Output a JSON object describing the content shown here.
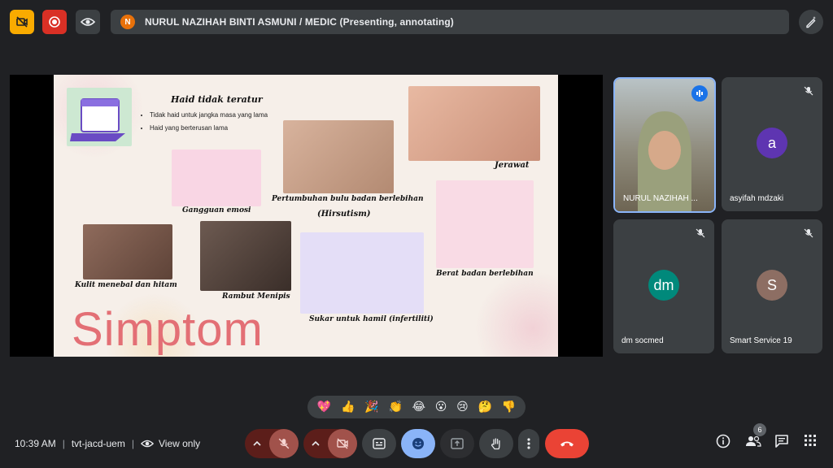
{
  "banner": {
    "presenter_initial": "N",
    "presenter_text": "NURUL NAZIHAH BINTI ASMUNI / MEDIC (Presenting, annotating)"
  },
  "slide": {
    "heading": "Haid tidak teratur",
    "bullets": [
      "Tidak haid untuk jangka masa yang lama",
      "Haid yang berterusan lama"
    ],
    "labels": {
      "gangguan": "Gangguan emosi",
      "pertumbuhan": "Pertumbuhan bulu badan berlebihan",
      "hirsutism": "(Hirsutism)",
      "jerawat": "Jerawat",
      "kulit": "Kulit menebal dan hitam",
      "rambut": "Rambut Menipis",
      "berat": "Berat badan berlebihan",
      "sukar": "Sukar untuk hamil (infertiliti)"
    },
    "title": "Simptom"
  },
  "participants": [
    {
      "name": "NURUL NAZIHAH ...",
      "type": "video"
    },
    {
      "name": "asyifah mdzaki",
      "initials": "a",
      "color": "#5e35b1"
    },
    {
      "name": "dm socmed",
      "initials": "dm",
      "color": "#00897b"
    },
    {
      "name": "Smart Service 19",
      "initials": "S",
      "color": "#8d6e63"
    }
  ],
  "reactions": [
    "💖",
    "👍",
    "🎉",
    "👏",
    "😂",
    "😮",
    "😢",
    "🤔",
    "👎"
  ],
  "meeting": {
    "time": "10:39 AM",
    "code": "tvt-jacd-uem",
    "view_mode": "View only"
  },
  "people_count": "6",
  "colors": {
    "background": "#202124",
    "tile": "#3c4043",
    "mic_off": "#8c2b25",
    "end_call": "#ea4335",
    "emoji_active": "#8ab4f8",
    "active_speaker_border": "#8ab4f8"
  }
}
